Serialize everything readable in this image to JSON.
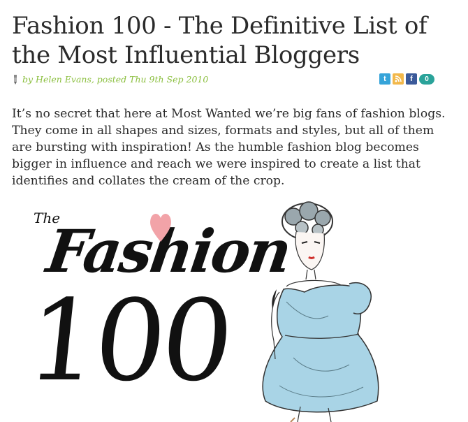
{
  "article": {
    "title": "Fashion 100 - The Definitive List of the Most Influential Bloggers",
    "byline": "by Helen Evans, posted Thu 9th Sep 2010",
    "comment_count": "0",
    "intro": "It’s no secret that here at Most Wanted we’re big fans of fashion blogs. They come in all shapes and sizes, formats and styles, but all of them are bursting with inspiration! As the humble fashion blog becomes bigger in influence and reach we were inspired to create a list that identifies and collates the cream of the crop."
  },
  "share": {
    "twitter_icon": "twitter-icon",
    "rss_icon": "rss-icon",
    "facebook_icon": "facebook-icon",
    "comments_icon": "comment-bubble-icon"
  },
  "hero": {
    "logo_the": "The",
    "logo_fashion": "Fashion",
    "logo_number": "100"
  },
  "colors": {
    "byline": "#8bbf3f",
    "twitter": "#36a4d9",
    "rss": "#f2b84b",
    "facebook": "#3b5a9a",
    "comments": "#2aa39a",
    "heart": "#f2a3a8",
    "dress": "#a9d4e6"
  }
}
